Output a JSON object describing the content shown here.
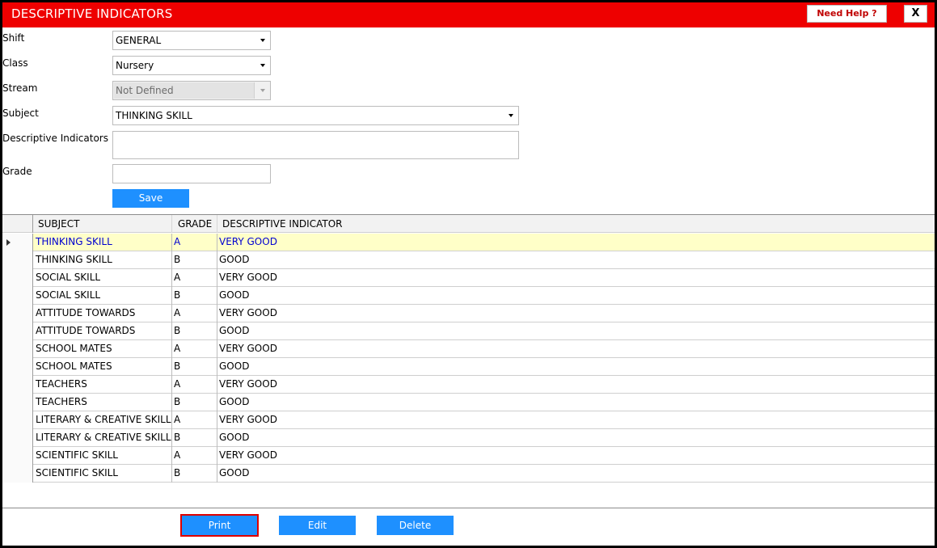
{
  "window": {
    "title": "DESCRIPTIVE INDICATORS",
    "help_label": "Need Help ?",
    "close_label": "X"
  },
  "form": {
    "shift": {
      "label": "Shift",
      "value": "GENERAL"
    },
    "class": {
      "label": "Class",
      "value": "Nursery"
    },
    "stream": {
      "label": "Stream",
      "value": "Not Defined"
    },
    "subject": {
      "label": "Subject",
      "value": "THINKING SKILL"
    },
    "descriptive_indicators": {
      "label": "Descriptive Indicators",
      "value": ""
    },
    "grade": {
      "label": "Grade",
      "value": ""
    },
    "save_label": "Save"
  },
  "table": {
    "columns": [
      "SUBJECT",
      "GRADE",
      "DESCRIPTIVE INDICATOR"
    ],
    "rows": [
      [
        "THINKING SKILL",
        "A",
        "VERY GOOD"
      ],
      [
        "THINKING SKILL",
        "B",
        "GOOD"
      ],
      [
        "SOCIAL SKILL",
        "A",
        "VERY GOOD"
      ],
      [
        "SOCIAL SKILL",
        "B",
        "GOOD"
      ],
      [
        "ATTITUDE TOWARDS",
        "A",
        "VERY GOOD"
      ],
      [
        "ATTITUDE TOWARDS",
        "B",
        "GOOD"
      ],
      [
        "SCHOOL MATES",
        "A",
        "VERY GOOD"
      ],
      [
        "SCHOOL MATES",
        "B",
        "GOOD"
      ],
      [
        "TEACHERS",
        "A",
        "VERY GOOD"
      ],
      [
        "TEACHERS",
        "B",
        "GOOD"
      ],
      [
        "LITERARY & CREATIVE SKILL",
        "A",
        "VERY GOOD"
      ],
      [
        "LITERARY & CREATIVE SKILL",
        "B",
        "GOOD"
      ],
      [
        "SCIENTIFIC SKILL",
        "A",
        "VERY GOOD"
      ],
      [
        "SCIENTIFIC SKILL",
        "B",
        "GOOD"
      ]
    ],
    "selected_row": 0
  },
  "actions": {
    "print_label": "Print",
    "edit_label": "Edit",
    "delete_label": "Delete"
  },
  "colors": {
    "title_bar": "#ee0000",
    "button_blue": "#1e90ff",
    "selected_row_bg": "#ffffc8",
    "selected_row_text": "#0000d0",
    "print_highlight_border": "#e00000"
  }
}
